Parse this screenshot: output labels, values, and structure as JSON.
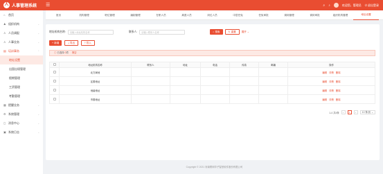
{
  "app": {
    "title": "人事管理系统",
    "logo_char": "人"
  },
  "header": {
    "menu_icon": "menu-icon",
    "bell": "bell-icon",
    "user_name": "欢迎您，管理员",
    "logout": "退出登录"
  },
  "tabs": [
    "首页",
    "机构管理",
    "职位管理",
    "编制管理",
    "在职人员",
    "离退人员",
    "岗位人员",
    "中层任免",
    "任免审批",
    "调岗管理",
    "调岗审批",
    "组织机构管理",
    "地址设置"
  ],
  "active_tab": 12,
  "sidebar": {
    "items": [
      {
        "label": "首页",
        "icon": "home-icon"
      },
      {
        "label": "组织机构",
        "icon": "org-icon",
        "arrow": "chevron-down-icon"
      },
      {
        "label": "人员调配",
        "icon": "person-icon",
        "arrow": "chevron-down-icon"
      },
      {
        "label": "人事业务",
        "icon": "user-icon",
        "arrow": "chevron-down-icon"
      },
      {
        "label": "培训事务",
        "icon": "book-icon",
        "arrow": "chevron-up-icon"
      }
    ],
    "subitems": [
      "地址设置",
      "出国出境管理",
      "假期管理",
      "工资管理",
      "考勤管理"
    ],
    "bottom": [
      {
        "label": "提醒业务",
        "icon": "clipboard-icon",
        "arrow": "chevron-down-icon"
      },
      {
        "label": "系统管理",
        "icon": "gear-icon",
        "arrow": "chevron-down-icon"
      },
      {
        "label": "消息中心",
        "icon": "chat-icon",
        "arrow": "chevron-down-icon"
      },
      {
        "label": "系统日志",
        "icon": "log-icon",
        "arrow": "chevron-down-icon"
      }
    ]
  },
  "search": {
    "label1": "地址机构名称:",
    "placeholder1": "请输入地址机构名称",
    "label2": "联系人:",
    "placeholder2": "请输入联系人名称",
    "search_btn": "搜索",
    "reset_btn": "重置",
    "expand": "展开"
  },
  "actions": {
    "add": "新增",
    "export": "导出",
    "import": "导入"
  },
  "alert": {
    "prefix": "已选择",
    "count": "0",
    "suffix": "项",
    "clear": "清空"
  },
  "table": {
    "headers": [
      "",
      "地址机构名称",
      "联系人",
      "地址",
      "电话",
      "传真",
      "邮编",
      "操作"
    ],
    "rows": [
      {
        "name": "北方局地"
      },
      {
        "name": "区委地址"
      },
      {
        "name": "地级地址"
      },
      {
        "name": "市委地址"
      }
    ],
    "ops": [
      "编辑",
      "详情",
      "删除"
    ]
  },
  "pager": {
    "summary": "1-4 共4条",
    "current": "1",
    "size": "10 条/页",
    "prev": "‹",
    "next": "›"
  },
  "footer": "Copyright © 2021 河南联网华子智慧软件股份有限公司"
}
